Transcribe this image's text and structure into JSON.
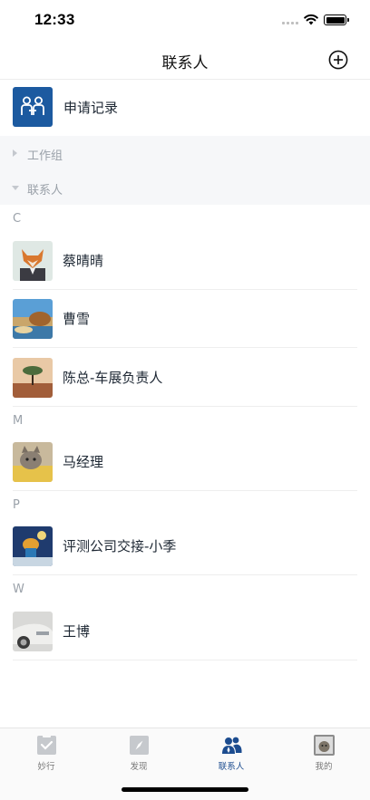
{
  "status_bar": {
    "time": "12:33"
  },
  "nav": {
    "title": "联系人",
    "add_icon": "plus-circle-icon"
  },
  "apply": {
    "label": "申请记录",
    "icon": "apply-record-icon",
    "icon_color": "#1c5aa0"
  },
  "groups": [
    {
      "label": "工作组",
      "expanded": false
    },
    {
      "label": "联系人",
      "expanded": true
    }
  ],
  "sections": [
    {
      "letter": "C",
      "contacts": [
        {
          "name": "蔡晴晴"
        },
        {
          "name": "曹雪"
        },
        {
          "name": "陈总-车展负责人"
        }
      ]
    },
    {
      "letter": "M",
      "contacts": [
        {
          "name": "马经理"
        }
      ]
    },
    {
      "letter": "P",
      "contacts": [
        {
          "name": "评测公司交接-小季"
        }
      ]
    },
    {
      "letter": "W",
      "contacts": [
        {
          "name": "王博"
        }
      ]
    }
  ],
  "tabs": [
    {
      "label": "妙行",
      "icon": "clipboard-check-icon",
      "active": false
    },
    {
      "label": "发现",
      "icon": "compass-icon",
      "active": false
    },
    {
      "label": "联系人",
      "icon": "contacts-icon",
      "active": true
    },
    {
      "label": "我的",
      "icon": "profile-avatar-icon",
      "active": false
    }
  ],
  "colors": {
    "accent": "#1c4c8f",
    "group_band": "#f6f7f9"
  }
}
